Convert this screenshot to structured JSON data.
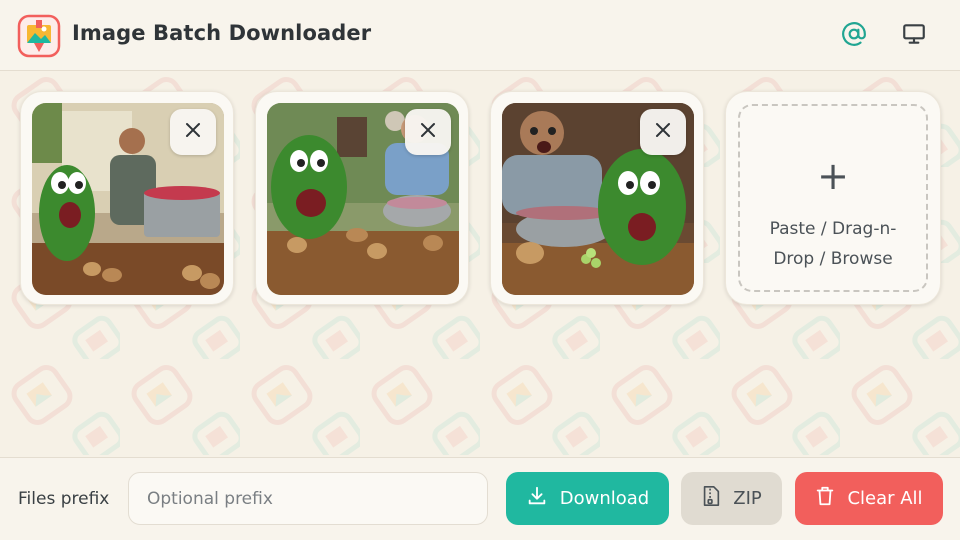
{
  "header": {
    "title": "Image Batch Downloader",
    "logo_icon": "app-logo-icon",
    "actions": [
      {
        "icon": "at-sign-icon",
        "color": "#20a592"
      },
      {
        "icon": "monitor-icon",
        "color": "#3a4044"
      }
    ]
  },
  "images": [
    {
      "alt": "Cartoon watermelon screaming in kitchen with man cooking berries",
      "remove_icon": "close-icon"
    },
    {
      "alt": "Cartoon watermelon screaming near boy stirring pot",
      "remove_icon": "close-icon"
    },
    {
      "alt": "Screaming man and frightened watermelon by steaming pot",
      "remove_icon": "close-icon"
    }
  ],
  "drop_zone": {
    "icon": "plus-icon",
    "plus": "+",
    "line1": "Paste / Drag-n-",
    "line2": "Drop / Browse"
  },
  "footer": {
    "prefix_label": "Files prefix",
    "prefix_placeholder": "Optional prefix",
    "prefix_value": "",
    "download_label": "Download",
    "zip_label": "ZIP",
    "clear_label": "Clear All"
  },
  "colors": {
    "accent": "#20b8a0",
    "danger": "#f25f5c",
    "neutral_button": "#e0dbd1",
    "background": "#f6f1e6"
  }
}
